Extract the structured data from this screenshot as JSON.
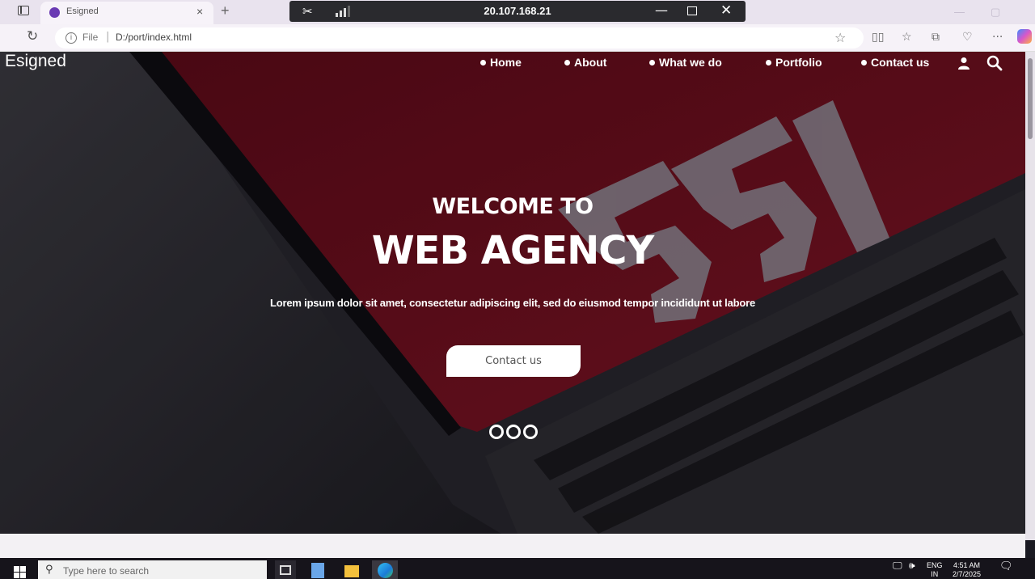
{
  "browser": {
    "tab_title": "Esigned",
    "tab_close": "×",
    "new_tab": "+",
    "url_scheme": "File",
    "url_path": "D:/port/index.html",
    "info": "i"
  },
  "remote_bar": {
    "title": "20.107.168.21",
    "minimize": "—",
    "close": "✕"
  },
  "site": {
    "brand": "Esigned",
    "nav": [
      {
        "label": "Home"
      },
      {
        "label": "About"
      },
      {
        "label": "What we do"
      },
      {
        "label": "Portfolio"
      },
      {
        "label": "Contact us"
      }
    ],
    "hero": {
      "subtitle": "WELCOME TO",
      "title": "WEB AGENCY",
      "text": "Lorem ipsum dolor sit amet, consectetur adipiscing elit, sed do eiusmod tempor incididunt ut labore",
      "button": "Contact us",
      "slides_count": 3
    },
    "background_text": "551"
  },
  "taskbar": {
    "search_placeholder": "Type here to search",
    "lang_top": "ENG",
    "lang_bottom": "IN",
    "time": "4:51 AM",
    "date": "2/7/2025"
  },
  "colors": {
    "hero_red": "#6b0d1e",
    "overlay_dark": "#23222a",
    "accent_purple": "#6a3ab3"
  }
}
